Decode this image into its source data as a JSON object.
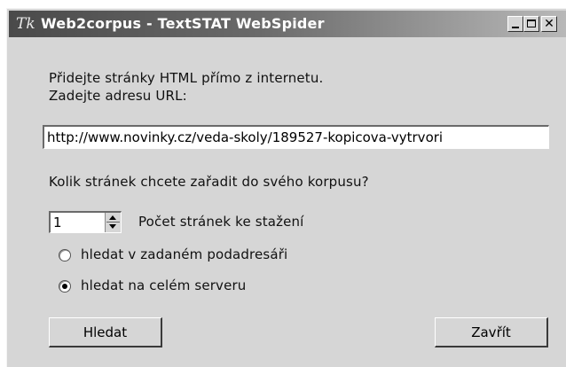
{
  "window": {
    "title": "Web2corpus - TextSTAT WebSpider",
    "icon": "textstat-app-icon",
    "icon_glyph": "Tk",
    "controls": {
      "minimize": "minimize-icon",
      "maximize": "maximize-icon",
      "close": "close-icon",
      "close_glyph": "✕"
    }
  },
  "form": {
    "intro_line1": "Přidejte stránky HTML přímo z internetu.",
    "intro_line2": "Zadejte adresu URL:",
    "url_value": "http://www.novinky.cz/veda-skoly/189527-kopicova-vytrvori",
    "question": "Kolik stránek chcete zařadit do svého korpusu?",
    "pages_count": "1",
    "pages_label": "Počet stránek ke stažení",
    "radio_subdirectory": {
      "label": "hledat v zadaném podadresáři",
      "selected": false
    },
    "radio_server": {
      "label": "hledat na celém serveru",
      "selected": true
    }
  },
  "buttons": {
    "search": "Hledat",
    "close": "Zavřít"
  }
}
